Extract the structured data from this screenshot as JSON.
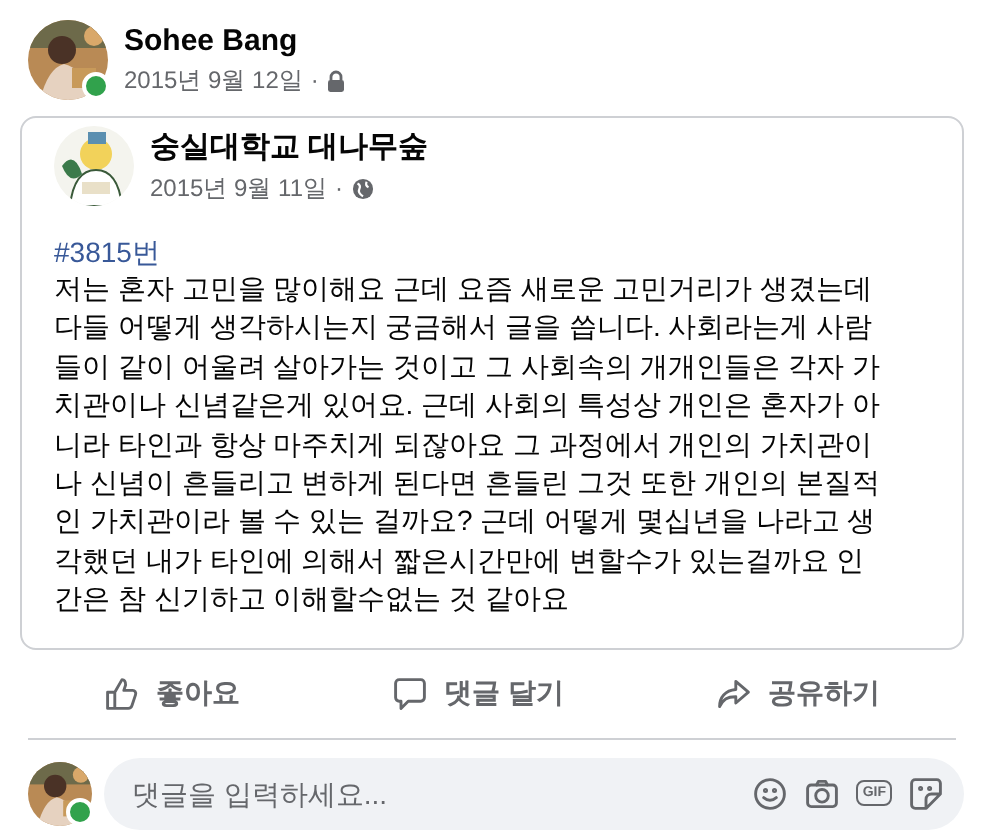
{
  "author": {
    "name": "Sohee Bang",
    "date": "2015년 9월 12일",
    "separator": "·",
    "online": true
  },
  "shared_post": {
    "page_name": "숭실대학교 대나무숲",
    "date": "2015년 9월 11일",
    "separator": "·",
    "hashtag": "#3815번",
    "body_lines": [
      "저는 혼자 고민을 많이해요 근데 요즘 새로운 고민거리가 생겼는데",
      "다들 어떻게 생각하시는지 궁금해서 글을 씁니다. 사회라는게 사람",
      "들이 같이 어울려 살아가는 것이고 그 사회속의 개개인들은 각자 가",
      "치관이나 신념같은게 있어요. 근데 사회의 특성상 개인은 혼자가 아",
      "니라 타인과 항상 마주치게 되잖아요 그 과정에서 개인의 가치관이",
      "나 신념이 흔들리고 변하게 된다면 흔들린 그것 또한 개인의 본질적",
      "인 가치관이라 볼 수 있는 걸까요? 근데 어떻게 몇십년을 나라고 생",
      "각했던 내가 타인에 의해서 짧은시간만에 변할수가 있는걸까요 인",
      "간은 참 신기하고 이해할수없는 것 같아요"
    ]
  },
  "actions": [
    {
      "kind": "like",
      "label": "좋아요"
    },
    {
      "kind": "comment",
      "label": "댓글 달기"
    },
    {
      "kind": "share",
      "label": "공유하기"
    }
  ],
  "comment_box": {
    "placeholder": "댓글을 입력하세요...",
    "online": true,
    "gif_label": "GIF"
  }
}
